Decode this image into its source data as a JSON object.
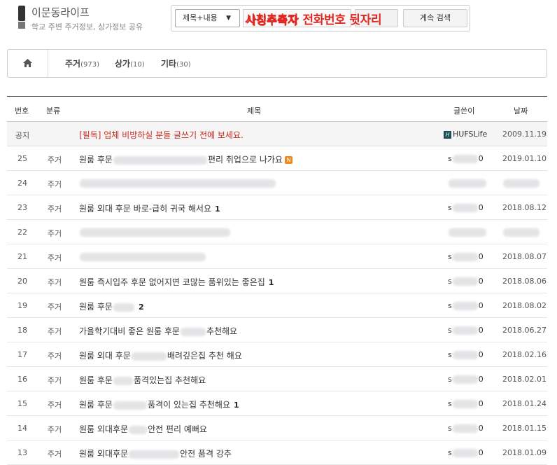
{
  "header": {
    "title": "이문동라이프",
    "subtitle": "학교 주변 주거정보, 상가정보 공유"
  },
  "search": {
    "scope": "제목+내용",
    "query": "사칭추측자",
    "next_label": "계속 검색"
  },
  "overlay_text": "사칭추측자 전화번호 뒷자리",
  "nav": {
    "tabs": [
      {
        "label": "주거",
        "count": "(973)"
      },
      {
        "label": "상가",
        "count": "(10)"
      },
      {
        "label": "기타",
        "count": "(30)"
      }
    ]
  },
  "table": {
    "headers": {
      "no": "번호",
      "category": "분류",
      "title": "제목",
      "author": "글쓴이",
      "date": "날짜"
    },
    "notice": {
      "no": "공지",
      "category": "",
      "title": "[필독] 업체 비방하실 분들 글쓰기 전에 보세요.",
      "author": "HUFSLife",
      "date": "2009.11.19"
    },
    "rows": [
      {
        "no": "25",
        "category": "주거",
        "t1": "원룸 후문",
        "t2": "편리 취업으로 나가요",
        "comments": "",
        "new": true,
        "author_a": "s",
        "author_b": "0",
        "date": "2019.01.10"
      },
      {
        "no": "24",
        "category": "주거",
        "t1": "",
        "t2": "",
        "comments": "",
        "new": false,
        "author_a": "",
        "author_b": "",
        "date": ""
      },
      {
        "no": "23",
        "category": "주거",
        "t1": "원룸 외대 후문 바로-급히 귀국 해서요",
        "t2": "",
        "comments": "1",
        "new": false,
        "author_a": "s",
        "author_b": "0",
        "date": "2018.08.12"
      },
      {
        "no": "22",
        "category": "주거",
        "t1": "",
        "t2": "",
        "comments": "",
        "new": false,
        "author_a": "",
        "author_b": "",
        "date": ""
      },
      {
        "no": "21",
        "category": "주거",
        "t1": "",
        "t2": "",
        "comments": "",
        "new": false,
        "author_a": "s",
        "author_b": "0",
        "date": "2018.08.07"
      },
      {
        "no": "20",
        "category": "주거",
        "t1": "원룸 즉시입주 후문 없어지면 코많는 품위있는 좋은집",
        "t2": "",
        "comments": "1",
        "new": false,
        "author_a": "s",
        "author_b": "0",
        "date": "2018.08.06"
      },
      {
        "no": "19",
        "category": "주거",
        "t1": "원룸 후문",
        "t2": "",
        "comments": "2",
        "new": false,
        "author_a": "s",
        "author_b": "0",
        "date": "2018.08.02"
      },
      {
        "no": "18",
        "category": "주거",
        "t1": "가을학기대비 좋은 원룸 후문",
        "t2": "추천해요",
        "comments": "",
        "new": false,
        "author_a": "s",
        "author_b": "0",
        "date": "2018.06.27"
      },
      {
        "no": "17",
        "category": "주거",
        "t1": "원룸 외대 후문",
        "t2": "배려깊은집 추천 해요",
        "comments": "",
        "new": false,
        "author_a": "s",
        "author_b": "0",
        "date": "2018.02.16"
      },
      {
        "no": "16",
        "category": "주거",
        "t1": "원룸 후문",
        "t2": "품격있는집 추천해요",
        "comments": "",
        "new": false,
        "author_a": "s",
        "author_b": "0",
        "date": "2018.02.01"
      },
      {
        "no": "15",
        "category": "주거",
        "t1": "원룸 후문",
        "t2": "품격이 있는집 추천해요",
        "comments": "1",
        "new": false,
        "author_a": "s",
        "author_b": "0",
        "date": "2018.01.24"
      },
      {
        "no": "14",
        "category": "주거",
        "t1": "원룸 외대후문",
        "t2": "안전 편리 예뻐요",
        "comments": "",
        "new": false,
        "author_a": "s",
        "author_b": "0",
        "date": "2018.01.15"
      },
      {
        "no": "13",
        "category": "주거",
        "t1": "원룸 외대후문",
        "t2": "안전 품격 강추",
        "comments": "",
        "new": false,
        "author_a": "s",
        "author_b": "0",
        "date": "2018.01.09"
      }
    ]
  },
  "colors": {
    "accent_red": "#e0271f",
    "notice_red": "#c8291e",
    "new_badge": "#f08a1a"
  }
}
